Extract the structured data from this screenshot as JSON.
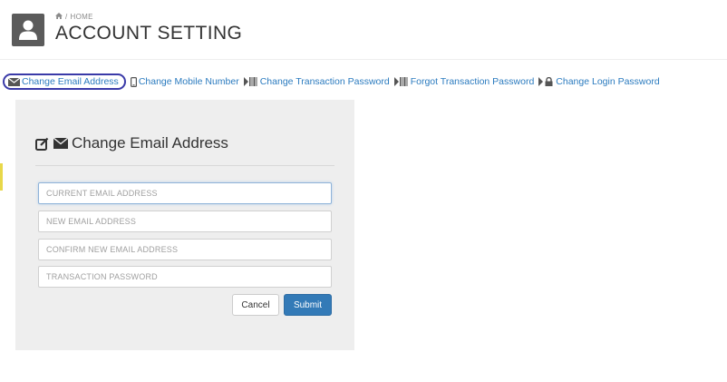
{
  "header": {
    "breadcrumb": "HOME",
    "title": "ACCOUNT SETTING"
  },
  "nav": {
    "items": [
      {
        "label": "Change Email Address",
        "icon": "envelope-icon"
      },
      {
        "label": "Change Mobile Number",
        "icon": "mobile-icon"
      },
      {
        "label": "Change Transaction Password",
        "icon": "barcode-icon"
      },
      {
        "label": "Forgot Transaction Password",
        "icon": "barcode-icon"
      },
      {
        "label": "Change Login Password",
        "icon": "lock-icon"
      }
    ],
    "active_color": "#3a3aa8",
    "link_color": "#2b7bbf"
  },
  "form": {
    "title": "Change Email Address",
    "fields": [
      {
        "placeholder": "CURRENT EMAIL ADDRESS"
      },
      {
        "placeholder": "NEW EMAIL ADDRESS"
      },
      {
        "placeholder": "CONFIRM NEW EMAIL ADDRESS"
      },
      {
        "placeholder": "TRANSACTION PASSWORD"
      }
    ],
    "cancel_label": "Cancel",
    "submit_label": "Submit",
    "submit_color": "#337ab7"
  }
}
